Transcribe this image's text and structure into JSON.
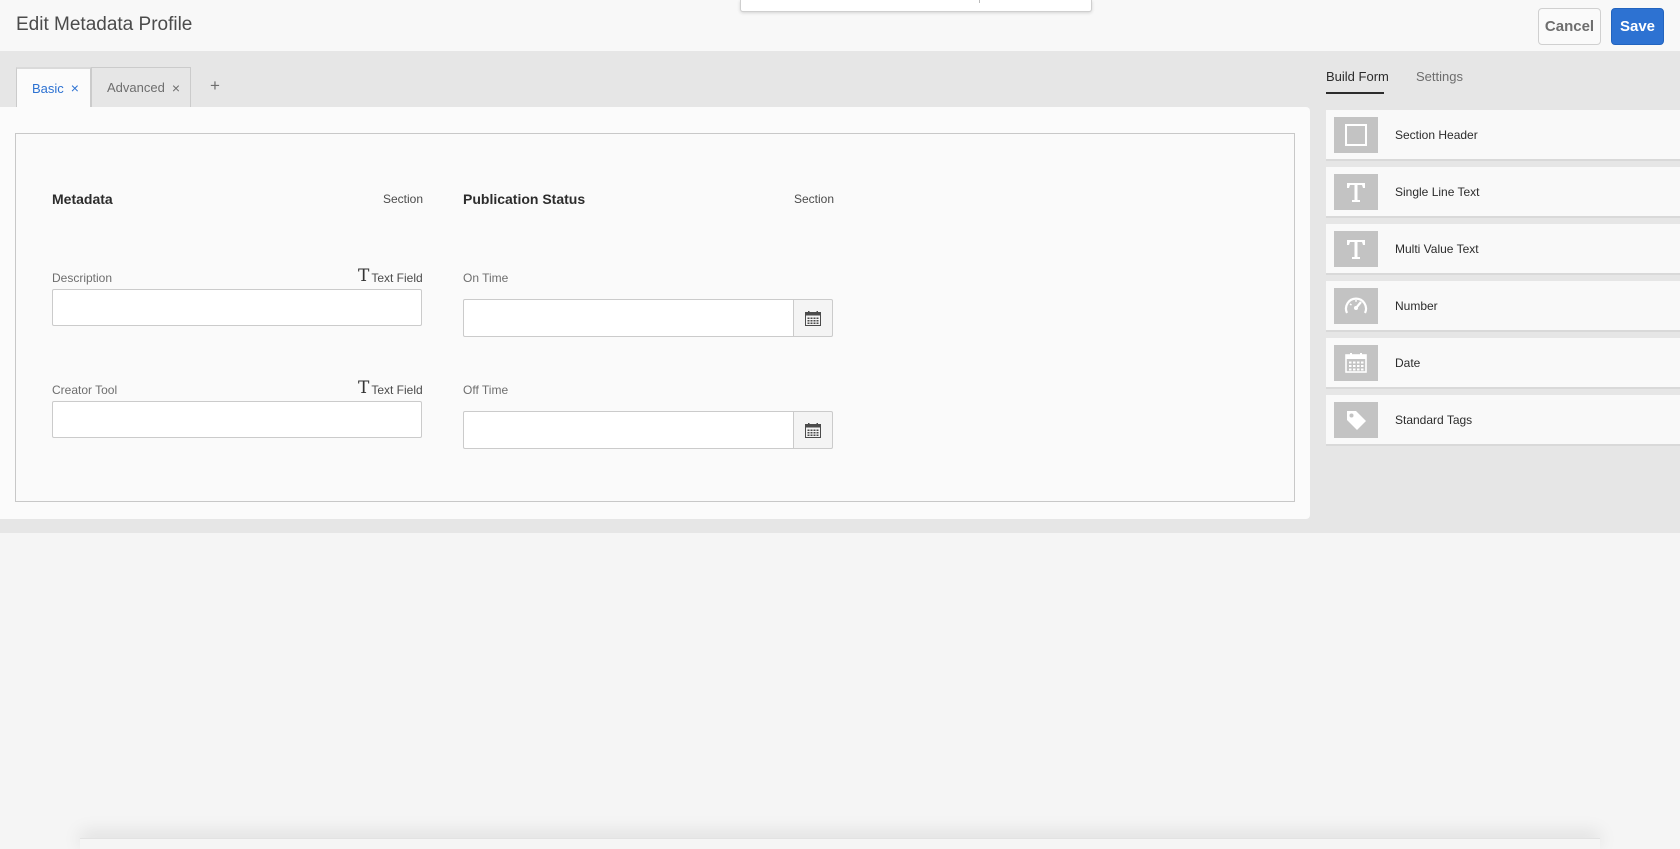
{
  "header": {
    "title": "Edit Metadata Profile",
    "cancel_label": "Cancel",
    "save_label": "Save",
    "accent_color": "#2d72d2"
  },
  "tabs": [
    {
      "label": "Basic",
      "active": true,
      "close": "×"
    },
    {
      "label": "Advanced",
      "active": false,
      "close": "×"
    }
  ],
  "add_tab_label": "+",
  "form": {
    "sections": [
      {
        "title": "Metadata",
        "type_label": "Section",
        "fields": [
          {
            "label": "Description",
            "type_label": "Text Field",
            "type_icon": "text-field-icon",
            "value": ""
          },
          {
            "label": "Creator Tool",
            "type_label": "Text Field",
            "type_icon": "text-field-icon",
            "value": ""
          }
        ]
      },
      {
        "title": "Publication Status",
        "type_label": "Section",
        "fields": [
          {
            "label": "On Time",
            "kind": "date",
            "value": "",
            "icon": "calendar-icon"
          },
          {
            "label": "Off Time",
            "kind": "date",
            "value": "",
            "icon": "calendar-icon"
          }
        ]
      }
    ]
  },
  "rail": {
    "tabs": [
      {
        "label": "Build Form",
        "active": true
      },
      {
        "label": "Settings",
        "active": false
      }
    ],
    "components": [
      {
        "label": "Section Header",
        "icon": "square-icon"
      },
      {
        "label": "Single Line Text",
        "icon": "text-t-icon"
      },
      {
        "label": "Multi Value Text",
        "icon": "text-t-icon"
      },
      {
        "label": "Number",
        "icon": "gauge-icon"
      },
      {
        "label": "Date",
        "icon": "calendar-icon"
      },
      {
        "label": "Standard Tags",
        "icon": "tag-icon"
      }
    ]
  }
}
